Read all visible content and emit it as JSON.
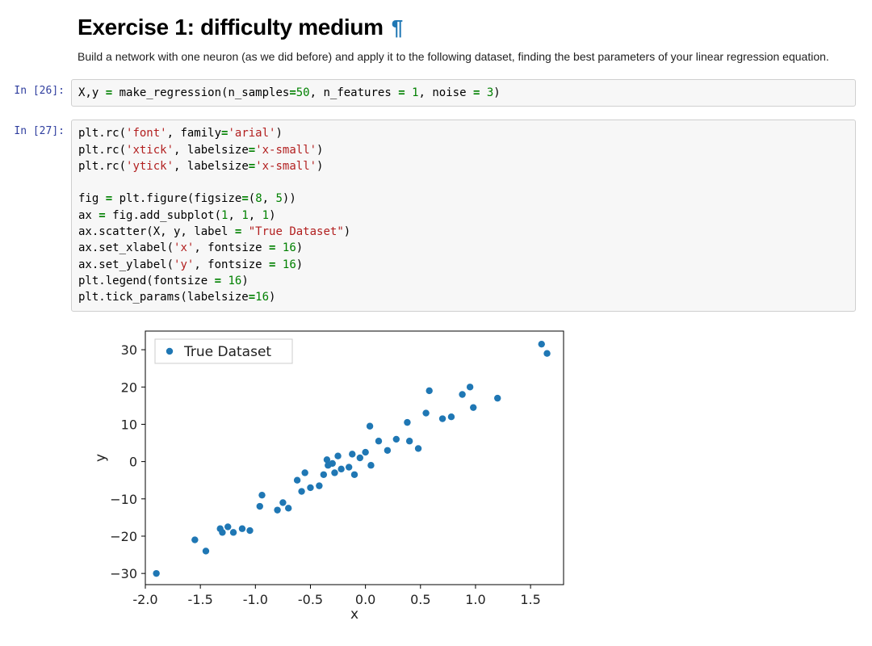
{
  "heading": "Exercise 1: difficulty medium",
  "md_text": "Build a network with one neuron (as we did before) and apply it to the following dataset, finding the best parameters of your linear regression equation.",
  "cells": {
    "c1": {
      "prompt": "In [26]:",
      "line1_a": "X,y ",
      "line1_eq": "=",
      "line1_b": " make_regression(n_samples",
      "line1_eq2": "=",
      "line1_n1": "50",
      "line1_c": ", n_features ",
      "line1_eq3": "=",
      "line1_sp": " ",
      "line1_n2": "1",
      "line1_d": ", noise ",
      "line1_eq4": "=",
      "line1_sp2": " ",
      "line1_n3": "3",
      "line1_e": ")"
    },
    "c2": {
      "prompt": "In [27]:",
      "l1a": "plt.rc(",
      "l1s1": "'font'",
      "l1b": ", family",
      "l1eq": "=",
      "l1s2": "'arial'",
      "l1c": ")",
      "l2a": "plt.rc(",
      "l2s1": "'xtick'",
      "l2b": ", labelsize",
      "l2eq": "=",
      "l2s2": "'x-small'",
      "l2c": ")",
      "l3a": "plt.rc(",
      "l3s1": "'ytick'",
      "l3b": ", labelsize",
      "l3eq": "=",
      "l3s2": "'x-small'",
      "l3c": ")",
      "l5a": "fig ",
      "l5eq": "=",
      "l5b": " plt.figure(figsize",
      "l5eq2": "=",
      "l5c": "(",
      "l5n1": "8",
      "l5d": ", ",
      "l5n2": "5",
      "l5e": "))",
      "l6a": "ax ",
      "l6eq": "=",
      "l6b": " fig.add_subplot(",
      "l6n1": "1",
      "l6c": ", ",
      "l6n2": "1",
      "l6d": ", ",
      "l6n3": "1",
      "l6e": ")",
      "l7a": "ax.scatter(X, y, label ",
      "l7eq": "=",
      "l7sp": " ",
      "l7s": "\"True Dataset\"",
      "l7b": ")",
      "l8a": "ax.set_xlabel(",
      "l8s": "'x'",
      "l8b": ", fontsize ",
      "l8eq": "=",
      "l8sp": " ",
      "l8n": "16",
      "l8c": ")",
      "l9a": "ax.set_ylabel(",
      "l9s": "'y'",
      "l9b": ", fontsize ",
      "l9eq": "=",
      "l9sp": " ",
      "l9n": "16",
      "l9c": ")",
      "l10a": "plt.legend(fontsize ",
      "l10eq": "=",
      "l10sp": " ",
      "l10n": "16",
      "l10b": ")",
      "l11a": "plt.tick_params(labelsize",
      "l11eq": "=",
      "l11n": "16",
      "l11b": ")"
    }
  },
  "chart_data": {
    "type": "scatter",
    "title": "",
    "xlabel": "x",
    "ylabel": "y",
    "xlim": [
      -2.0,
      1.8
    ],
    "ylim": [
      -33,
      35
    ],
    "xticks": [
      -2.0,
      -1.5,
      -1.0,
      -0.5,
      0.0,
      0.5,
      1.0,
      1.5
    ],
    "yticks": [
      -30,
      -20,
      -10,
      0,
      10,
      20,
      30
    ],
    "legend": {
      "label": "True Dataset"
    },
    "series": [
      {
        "name": "True Dataset",
        "points": [
          [
            -1.9,
            -30.0
          ],
          [
            -1.55,
            -21.0
          ],
          [
            -1.45,
            -24.0
          ],
          [
            -1.32,
            -18.0
          ],
          [
            -1.3,
            -19.0
          ],
          [
            -1.25,
            -17.5
          ],
          [
            -1.2,
            -19.0
          ],
          [
            -1.12,
            -18.0
          ],
          [
            -1.05,
            -18.5
          ],
          [
            -0.96,
            -12.0
          ],
          [
            -0.94,
            -9.0
          ],
          [
            -0.8,
            -13.0
          ],
          [
            -0.75,
            -11.0
          ],
          [
            -0.7,
            -12.5
          ],
          [
            -0.62,
            -5.0
          ],
          [
            -0.58,
            -8.0
          ],
          [
            -0.55,
            -3.0
          ],
          [
            -0.5,
            -7.0
          ],
          [
            -0.42,
            -6.5
          ],
          [
            -0.38,
            -3.5
          ],
          [
            -0.35,
            0.5
          ],
          [
            -0.34,
            -1.0
          ],
          [
            -0.3,
            -0.5
          ],
          [
            -0.28,
            -3.0
          ],
          [
            -0.25,
            1.5
          ],
          [
            -0.22,
            -2.0
          ],
          [
            -0.15,
            -1.5
          ],
          [
            -0.12,
            2.0
          ],
          [
            -0.1,
            -3.5
          ],
          [
            -0.05,
            1.0
          ],
          [
            0.0,
            2.5
          ],
          [
            0.04,
            9.5
          ],
          [
            0.05,
            -1.0
          ],
          [
            0.12,
            5.5
          ],
          [
            0.2,
            3.0
          ],
          [
            0.28,
            6.0
          ],
          [
            0.38,
            10.5
          ],
          [
            0.4,
            5.5
          ],
          [
            0.48,
            3.5
          ],
          [
            0.55,
            13.0
          ],
          [
            0.58,
            19.0
          ],
          [
            0.7,
            11.5
          ],
          [
            0.78,
            12.0
          ],
          [
            0.88,
            18.0
          ],
          [
            0.95,
            20.0
          ],
          [
            0.98,
            14.5
          ],
          [
            1.2,
            17.0
          ],
          [
            1.6,
            31.5
          ],
          [
            1.65,
            29.0
          ]
        ]
      }
    ]
  }
}
